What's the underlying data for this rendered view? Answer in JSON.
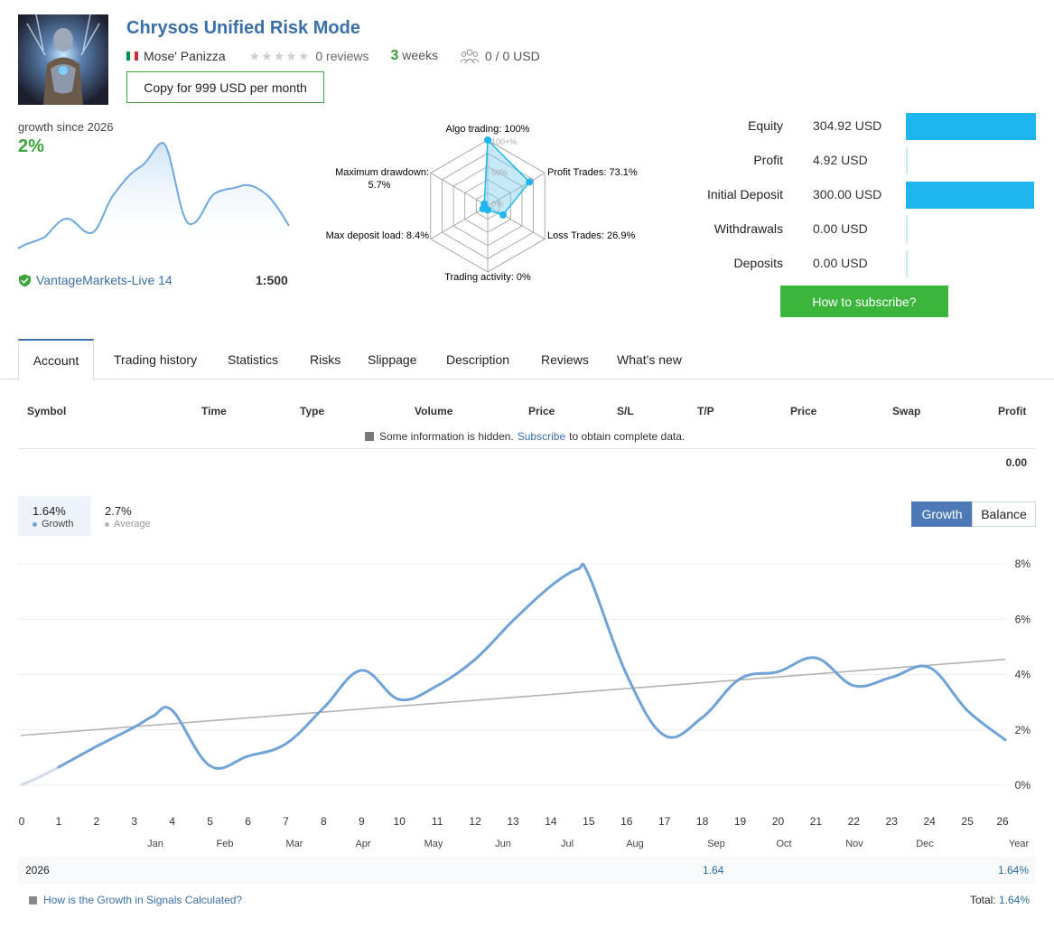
{
  "header": {
    "title": "Chrysos Unified Risk Mode",
    "author": "Mose' Panizza",
    "stars": "★★★★★",
    "reviews": "0 reviews",
    "weeks_num": "3",
    "weeks_label": " weeks",
    "subscribers": "0 / 0 USD",
    "copy_button": "Copy for 999 USD per month",
    "flag_colors": [
      "#009246",
      "#ffffff",
      "#ce2b37"
    ]
  },
  "growth_mini": {
    "label": "growth since 2026",
    "value": "2%",
    "broker": "VantageMarkets-Live 14",
    "leverage": "1:500"
  },
  "radar": {
    "labels": {
      "algo": "Algo trading: 100%",
      "profit": "Profit Trades: 73.1%",
      "loss": "Loss Trades: 26.9%",
      "activity": "Trading activity: 0%",
      "deposit_load": "Max deposit load: 8.4%",
      "drawdown_1": "Maximum drawdown:",
      "drawdown_2": "5.7%"
    },
    "scale": {
      "top": "100+%",
      "mid": "50%",
      "low": "0%"
    },
    "values": [
      1.0,
      0.731,
      0.269,
      0.0,
      0.084,
      0.057
    ]
  },
  "stats": [
    {
      "name": "Equity",
      "value": "304.92 USD",
      "amount": 304.92
    },
    {
      "name": "Profit",
      "value": "4.92 USD",
      "amount": 4.92
    },
    {
      "name": "Initial Deposit",
      "value": "300.00 USD",
      "amount": 300.0
    },
    {
      "name": "Withdrawals",
      "value": "0.00 USD",
      "amount": 0
    },
    {
      "name": "Deposits",
      "value": "0.00 USD",
      "amount": 0
    }
  ],
  "subscribe_button": "How to subscribe?",
  "tabs": [
    "Account",
    "Trading history",
    "Statistics",
    "Risks",
    "Slippage",
    "Description",
    "Reviews",
    "What's new"
  ],
  "table": {
    "headers": [
      "Symbol",
      "Time",
      "Type",
      "Volume",
      "Price",
      "S/L",
      "T/P",
      "Price",
      "Swap",
      "Profit"
    ],
    "hidden_prefix": "Some information is hidden.",
    "hidden_link": "Subscribe",
    "hidden_suffix": "to obtain complete data.",
    "total_profit": "0.00"
  },
  "legend": {
    "growth_value": "1.64%",
    "growth_name": "Growth",
    "average_value": "2.7%",
    "average_name": "Average"
  },
  "toggle": {
    "growth": "Growth",
    "balance": "Balance"
  },
  "chart_data": {
    "type": "line",
    "x": [
      0,
      0.5,
      1,
      2,
      3,
      3.5,
      4,
      5,
      6,
      7,
      8,
      9,
      10,
      11,
      12,
      13,
      14,
      14.7,
      15,
      16,
      17,
      18,
      19,
      20,
      21,
      22,
      23,
      24,
      25,
      26
    ],
    "series": [
      {
        "name": "Growth",
        "color": "#6fa3d8",
        "values": [
          0,
          0.3,
          0.65,
          1.4,
          2.1,
          2.5,
          2.7,
          0.7,
          1.05,
          1.5,
          2.8,
          4.15,
          3.1,
          3.6,
          4.55,
          5.95,
          7.2,
          7.8,
          7.6,
          4.0,
          1.8,
          2.45,
          3.85,
          4.1,
          4.6,
          3.6,
          3.9,
          4.25,
          2.7,
          1.64
        ]
      },
      {
        "name": "Average",
        "color": "#b3b3b3",
        "values": [
          1.8,
          4.55
        ],
        "x": [
          0,
          26
        ]
      }
    ],
    "xlim": [
      0,
      26
    ],
    "ylim": [
      0,
      8
    ],
    "x_ticks": [
      "0",
      "1",
      "2",
      "3",
      "4",
      "5",
      "6",
      "7",
      "8",
      "9",
      "10",
      "11",
      "12",
      "13",
      "14",
      "15",
      "16",
      "17",
      "18",
      "19",
      "20",
      "21",
      "22",
      "23",
      "24",
      "25",
      "26"
    ],
    "y_ticks": [
      "0%",
      "2%",
      "4%",
      "6%",
      "8%"
    ],
    "months": [
      "Jan",
      "Feb",
      "Mar",
      "Apr",
      "May",
      "Jun",
      "Jul",
      "Aug",
      "Sep",
      "Oct",
      "Nov",
      "Dec",
      "Year"
    ],
    "grid": true
  },
  "year_row": {
    "year": "2026",
    "sep_value": "1.64",
    "total": "1.64%"
  },
  "footer": {
    "how_link": "How is the Growth in Signals Calculated?",
    "total_label": "Total: ",
    "total_value": "1.64%"
  }
}
